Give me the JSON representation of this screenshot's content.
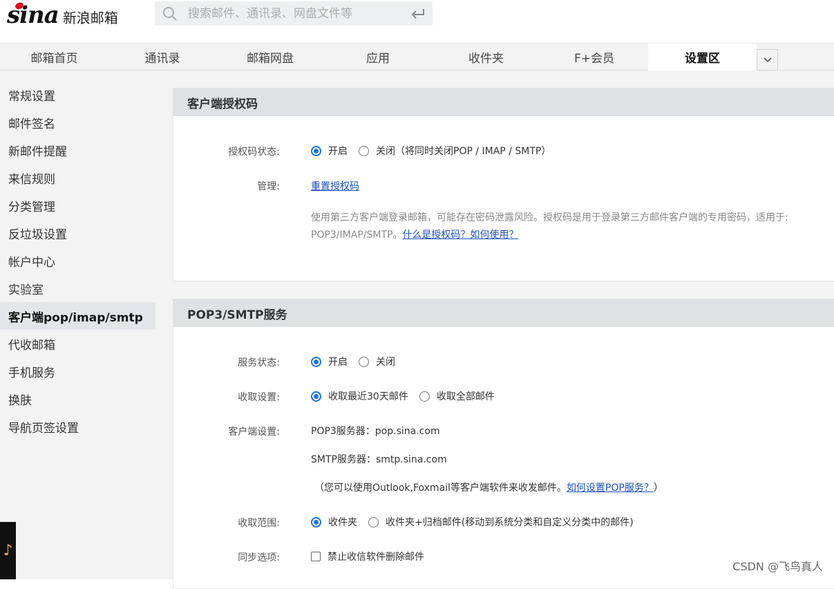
{
  "brand": {
    "logo_text": "sina",
    "name": "新浪邮箱"
  },
  "search": {
    "placeholder": "搜索邮件、通讯录、网盘文件等"
  },
  "nav": {
    "tabs": [
      {
        "label": "邮箱首页"
      },
      {
        "label": "通讯录"
      },
      {
        "label": "邮箱网盘"
      },
      {
        "label": "应用"
      },
      {
        "label": "收件夹"
      },
      {
        "label": "F+会员"
      },
      {
        "label": "设置区"
      }
    ],
    "active": "设置区"
  },
  "sidebar": {
    "items": [
      {
        "label": "常规设置"
      },
      {
        "label": "邮件签名"
      },
      {
        "label": "新邮件提醒"
      },
      {
        "label": "来信规则"
      },
      {
        "label": "分类管理"
      },
      {
        "label": "反垃圾设置"
      },
      {
        "label": "帐户中心"
      },
      {
        "label": "实验室"
      },
      {
        "label": "客户端pop/imap/smtp"
      },
      {
        "label": "代收邮箱"
      },
      {
        "label": "手机服务"
      },
      {
        "label": "换肤"
      },
      {
        "label": "导航页签设置"
      }
    ],
    "active": "客户端pop/imap/smtp"
  },
  "auth_panel": {
    "title": "客户端授权码",
    "status_label": "授权码状态:",
    "status_on": "开启",
    "status_off": "关闭（将同时关闭POP / IMAP / SMTP）",
    "status_selected": "开启",
    "manage_label": "管理:",
    "manage_link": "重置授权码",
    "desc_line1": "使用第三方客户端登录邮箱，可能存在密码泄露风险。授权码是用于登录第三方邮件客户端的专用密码，适用于:",
    "desc_line2_prefix": "POP3/IMAP/SMTP。",
    "desc_link": "什么是授权码？如何使用？"
  },
  "pop_panel": {
    "title": "POP3/SMTP服务",
    "service_label": "服务状态:",
    "service_on": "开启",
    "service_off": "关闭",
    "service_selected": "开启",
    "fetch_label": "收取设置:",
    "fetch_recent": "收取最近30天邮件",
    "fetch_all": "收取全部邮件",
    "fetch_selected": "收取最近30天邮件",
    "client_label": "客户端设置:",
    "pop3_server": "POP3服务器：pop.sina.com",
    "smtp_server": "SMTP服务器：smtp.sina.com",
    "client_note_prefix": "（您可以使用Outlook,Foxmail等客户端软件来收发邮件。",
    "client_note_link": "如何设置POP服务？",
    "client_note_suffix": "）",
    "range_label": "收取范围:",
    "range_inbox": "收件夹",
    "range_archive": "收件夹+归档邮件(移动到系统分类和自定义分类中的邮件)",
    "range_selected": "收件夹",
    "sync_label": "同步选项:",
    "sync_option": "禁止收信软件删除邮件",
    "sync_checked": false
  },
  "watermark": "CSDN @飞鸟真人"
}
